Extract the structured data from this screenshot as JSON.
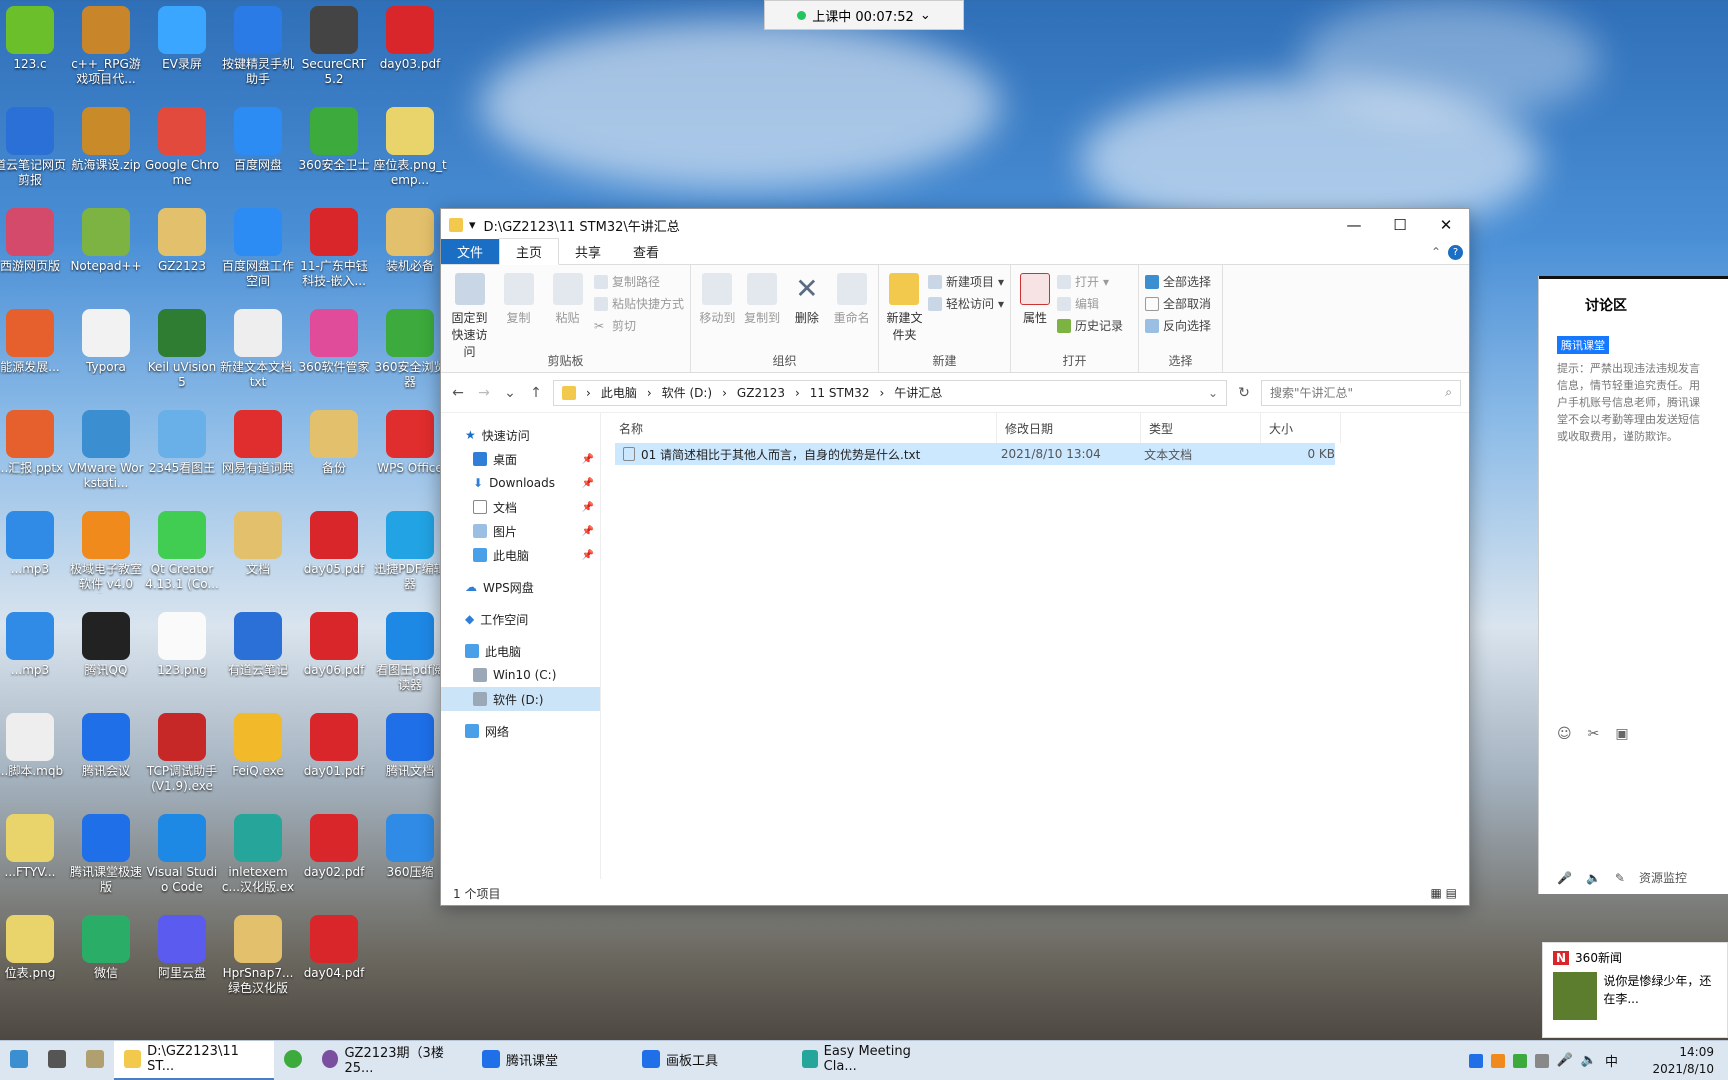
{
  "top_timer": {
    "text": "上课中 00:07:52"
  },
  "desktop": {
    "icons": [
      {
        "label": "123.c",
        "color": "#6bbf2a"
      },
      {
        "label": "c++_RPG游戏项目代...",
        "color": "#c9852a"
      },
      {
        "label": "EV录屏",
        "color": "#3aa6ff"
      },
      {
        "label": "按键精灵手机助手",
        "color": "#2b7be6"
      },
      {
        "label": "SecureCRT 5.2",
        "color": "#444"
      },
      {
        "label": "day03.pdf",
        "color": "#d8262b"
      },
      {
        "label": "道云笔记网页剪报",
        "color": "#2a70d6"
      },
      {
        "label": "航海课设.zip",
        "color": "#c98a2a"
      },
      {
        "label": "Google Chrome",
        "color": "#e14a3c"
      },
      {
        "label": "百度网盘",
        "color": "#2c8cf4"
      },
      {
        "label": "360安全卫士",
        "color": "#3caa3c"
      },
      {
        "label": "座位表.png_temp...",
        "color": "#e8d46a"
      },
      {
        "label": "西游网页版",
        "color": "#d44a6a"
      },
      {
        "label": "Notepad++",
        "color": "#7cb342"
      },
      {
        "label": "GZ2123",
        "color": "#e3c06b"
      },
      {
        "label": "百度网盘工作空间",
        "color": "#2c8cf4"
      },
      {
        "label": "11-广东中钰科技-嵌入...",
        "color": "#d8262b"
      },
      {
        "label": "装机必备",
        "color": "#e3c06b"
      },
      {
        "label": "能源发展...",
        "color": "#e5602c"
      },
      {
        "label": "Typora",
        "color": "#f2f2f2"
      },
      {
        "label": "Keil uVision5",
        "color": "#2e7d32"
      },
      {
        "label": "新建文本文档.txt",
        "color": "#eeeeee"
      },
      {
        "label": "360软件管家",
        "color": "#e04b9a"
      },
      {
        "label": "360安全浏览器",
        "color": "#3caa3c"
      },
      {
        "label": "...汇报.pptx",
        "color": "#e5602c"
      },
      {
        "label": "VMware Workstati...",
        "color": "#3b8ed0"
      },
      {
        "label": "2345看图王",
        "color": "#6ab0e8"
      },
      {
        "label": "网易有道词典",
        "color": "#e02d2d"
      },
      {
        "label": "备份",
        "color": "#e3c06b"
      },
      {
        "label": "WPS Office",
        "color": "#e02d2d"
      },
      {
        "label": "...mp3",
        "color": "#2f8be5"
      },
      {
        "label": "极域电子教室软件 v4.0 2...",
        "color": "#f08a1c"
      },
      {
        "label": "Qt Creator 4.13.1 (Co...",
        "color": "#41cd52"
      },
      {
        "label": "文档",
        "color": "#e3c06b"
      },
      {
        "label": "day05.pdf",
        "color": "#d8262b"
      },
      {
        "label": "迅捷PDF编辑器",
        "color": "#22a3e3"
      },
      {
        "label": "...mp3",
        "color": "#2f8be5"
      },
      {
        "label": "腾讯QQ",
        "color": "#222"
      },
      {
        "label": "123.png",
        "color": "#fafafa"
      },
      {
        "label": "有道云笔记",
        "color": "#2a70d6"
      },
      {
        "label": "day06.pdf",
        "color": "#d8262b"
      },
      {
        "label": "看图王pdf阅读器",
        "color": "#1e88e5"
      },
      {
        "label": "...脚本.mqb",
        "color": "#eeeeee"
      },
      {
        "label": "腾讯会议",
        "color": "#1e6fe8"
      },
      {
        "label": "TCP调试助手(V1.9).exe",
        "color": "#c62828"
      },
      {
        "label": "FeiQ.exe",
        "color": "#f2b92a"
      },
      {
        "label": "day01.pdf",
        "color": "#d8262b"
      },
      {
        "label": "腾讯文档",
        "color": "#1e6fe8"
      },
      {
        "label": "...FTYV...",
        "color": "#e8d46a"
      },
      {
        "label": "腾讯课堂极速版",
        "color": "#1e6fe8"
      },
      {
        "label": "Visual Studio Code",
        "color": "#1e88e5"
      },
      {
        "label": "inletexemc...汉化版.exe",
        "color": "#26a69a"
      },
      {
        "label": "day02.pdf",
        "color": "#d8262b"
      },
      {
        "label": "360压缩",
        "color": "#2f8be5"
      },
      {
        "label": "位表.png",
        "color": "#e8d46a"
      },
      {
        "label": "微信",
        "color": "#2aae67"
      },
      {
        "label": "阿里云盘",
        "color": "#5b5bf0"
      },
      {
        "label": "HprSnap7...绿色汉化版",
        "color": "#e3c06b"
      },
      {
        "label": "day04.pdf",
        "color": "#d8262b"
      }
    ]
  },
  "explorer": {
    "title": "D:\\GZ2123\\11 STM32\\午讲汇总",
    "tabs": [
      "文件",
      "主页",
      "共享",
      "查看"
    ],
    "ribbon": {
      "clipboard": {
        "pin": "固定到快速访问",
        "copy": "复制",
        "paste": "粘贴",
        "copy_path": "复制路径",
        "paste_shortcut": "粘贴快捷方式",
        "cut": "剪切",
        "label": "剪贴板"
      },
      "organize": {
        "move": "移动到",
        "copyto": "复制到",
        "delete": "删除",
        "rename": "重命名",
        "label": "组织"
      },
      "new": {
        "folder": "新建文件夹",
        "item": "新建项目",
        "easy": "轻松访问",
        "label": "新建"
      },
      "open": {
        "props": "属性",
        "open": "打开",
        "edit": "编辑",
        "history": "历史记录",
        "label": "打开"
      },
      "select": {
        "all": "全部选择",
        "none": "全部取消",
        "invert": "反向选择",
        "label": "选择"
      }
    },
    "path": [
      "此电脑",
      "软件 (D:)",
      "GZ2123",
      "11 STM32",
      "午讲汇总"
    ],
    "search_placeholder": "搜索\"午讲汇总\"",
    "nav": {
      "quick": "快速访问",
      "desktop": "桌面",
      "downloads": "Downloads",
      "docs": "文档",
      "pics": "图片",
      "pc_q": "此电脑",
      "wps": "WPS网盘",
      "work": "工作空间",
      "pc": "此电脑",
      "c": "Win10 (C:)",
      "d": "软件 (D:)",
      "net": "网络"
    },
    "columns": {
      "name": "名称",
      "date": "修改日期",
      "type": "类型",
      "size": "大小"
    },
    "file": {
      "name": "01 请简述相比于其他人而言，自身的优势是什么.txt",
      "date": "2021/8/10 13:04",
      "type": "文本文档",
      "size": "0 KB"
    },
    "status": "1 个项目"
  },
  "side": {
    "tab": "讨论区",
    "badge": "腾讯课堂",
    "tip": "提示：严禁出现违法违规发言信息，情节轻重追究责任。用户手机账号信息老师，腾讯课堂不会以考勤等理由发送短信或收取费用，谨防欺诈。",
    "footer": "资源监控"
  },
  "news": {
    "title": "360新闻",
    "text": "说你是惨绿少年，还在李..."
  },
  "taskbar": {
    "items": [
      "D:\\GZ2123\\11 ST...",
      "GZ2123期（3楼25...",
      "腾讯课堂",
      "画板工具",
      "Easy Meeting Cla..."
    ],
    "time": "14:09",
    "date": "2021/8/10",
    "ime": "中"
  }
}
